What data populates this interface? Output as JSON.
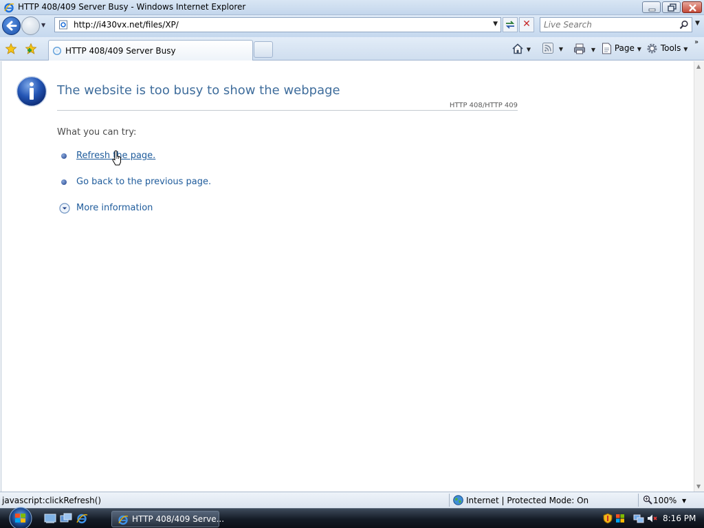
{
  "window": {
    "title": "HTTP 408/409 Server Busy - Windows Internet Explorer"
  },
  "navbar": {
    "address": "http://i430vx.net/files/XP/",
    "search_placeholder": "Live Search"
  },
  "tabs": {
    "active_label": "HTTP 408/409 Server Busy"
  },
  "commandbar": {
    "page_label": "Page",
    "tools_label": "Tools"
  },
  "content": {
    "headline": "The website is too busy to show the webpage",
    "error_code": "HTTP 408/HTTP 409",
    "try_label": "What you can try:",
    "options": [
      {
        "label": "Refresh the page."
      },
      {
        "label": "Go back to the previous page."
      }
    ],
    "more_info": "More information"
  },
  "statusbar": {
    "status_text": "javascript:clickRefresh()",
    "zone": "Internet | Protected Mode: On",
    "zoom": "100%"
  },
  "taskbar": {
    "task_label": "HTTP 408/409 Serve...",
    "clock": "8:16 PM"
  },
  "colors": {
    "headline": "#3f6d9c",
    "link": "#1e5b9b",
    "chrome": "#cfdeef",
    "taskbar": "#141b26"
  },
  "icons": {
    "info": "info-icon",
    "favorites": "favorites-star-icon",
    "home": "home-icon",
    "feeds": "feeds-icon",
    "print": "printer-icon",
    "tools": "gear-icon"
  }
}
